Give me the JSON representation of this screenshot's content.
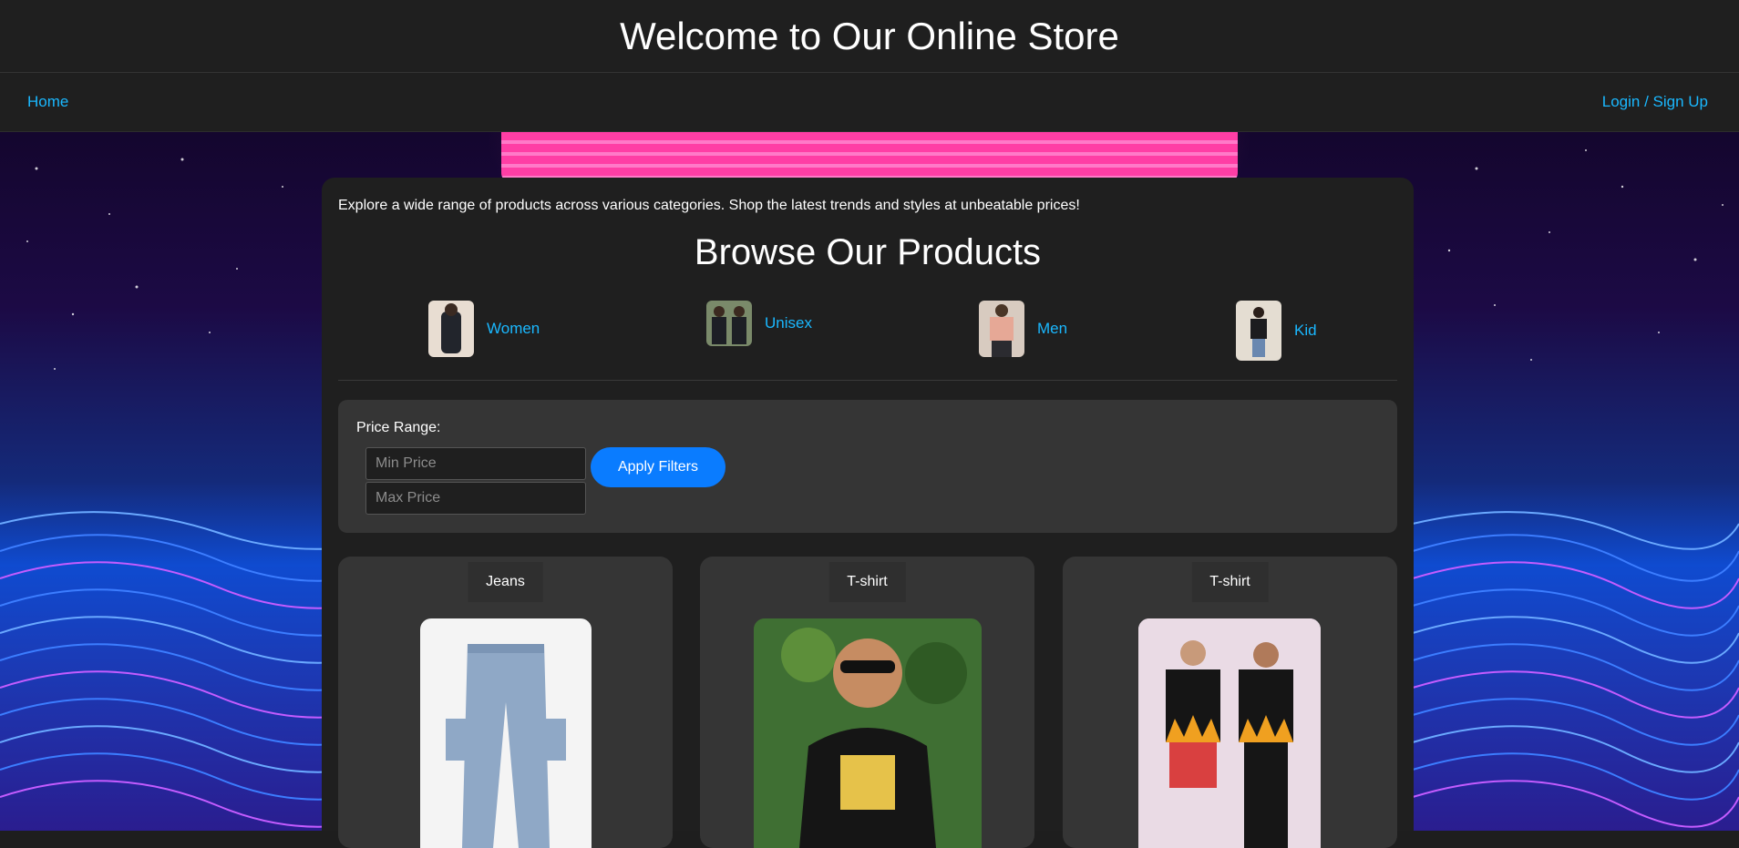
{
  "header": {
    "title": "Welcome to Our Online Store"
  },
  "nav": {
    "home": "Home",
    "login": "Login / Sign Up"
  },
  "intro": "Explore a wide range of products across various categories. Shop the latest trends and styles at unbeatable prices!",
  "browse_title": "Browse Our Products",
  "categories": [
    {
      "label": "Women"
    },
    {
      "label": "Unisex"
    },
    {
      "label": "Men"
    },
    {
      "label": "Kid"
    }
  ],
  "filters": {
    "label": "Price Range:",
    "min_placeholder": "Min Price",
    "max_placeholder": "Max Price",
    "apply_label": "Apply Filters"
  },
  "products": [
    {
      "title": "Jeans"
    },
    {
      "title": "T-shirt"
    },
    {
      "title": "T-shirt"
    }
  ],
  "colors": {
    "accent_link": "#1ab8ff",
    "button": "#0a7cff",
    "panel": "#1f1f1f",
    "card": "#353535"
  }
}
